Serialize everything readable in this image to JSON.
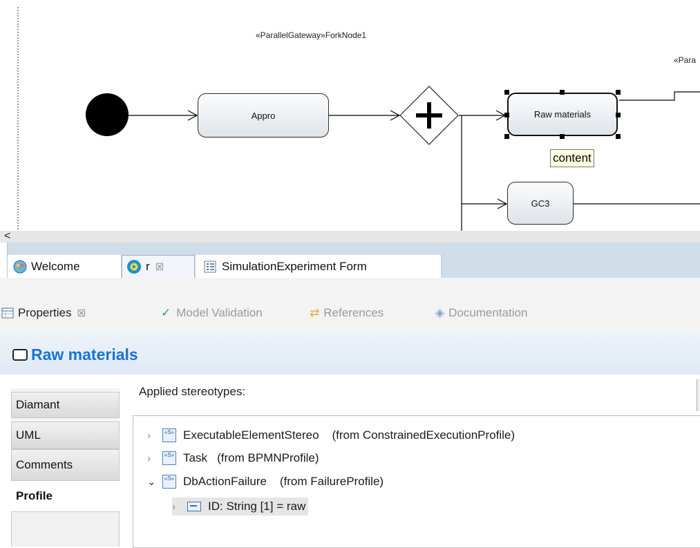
{
  "diagram": {
    "stereotype_fork": "«ParallelGateway»ForkNode1",
    "stereotype_right": "«Para",
    "node_appro": "Appro",
    "node_raw": "Raw materials",
    "node_gc3": "GC3",
    "tooltip": "content"
  },
  "editor_tabs": [
    {
      "label": "Welcome",
      "icon": "welcome-icon"
    },
    {
      "label": "r",
      "icon": "diagram-icon",
      "close": "☒"
    },
    {
      "label": "SimulationExperiment Form",
      "icon": "form-icon"
    }
  ],
  "view_tabs": [
    {
      "label": "Properties",
      "icon": "properties-icon",
      "close": "☒"
    },
    {
      "label": "Model Validation",
      "icon": "check-icon"
    },
    {
      "label": "References",
      "icon": "references-icon"
    },
    {
      "label": "Documentation",
      "icon": "documentation-icon"
    }
  ],
  "properties": {
    "title": "Raw materials",
    "side_tabs": [
      "Diamant",
      "UML",
      "Comments",
      "Profile"
    ],
    "selected_tab": "Profile",
    "applied_label": "Applied stereotypes:",
    "tree": [
      {
        "name": "ExecutableElementStereo",
        "from": "(from ConstrainedExecutionProfile)",
        "expanded": false
      },
      {
        "name": "Task",
        "from": "(from BPMNProfile)",
        "expanded": false
      },
      {
        "name": "DbActionFailure",
        "from": "(from FailureProfile)",
        "expanded": true
      },
      {
        "name": "ID: String [1] = raw",
        "from": "",
        "expanded": false
      }
    ]
  },
  "scroll": {
    "left_arrow": "<"
  },
  "colors": {
    "title_blue": "#1873d6",
    "tab_bar": "#cfdde9"
  }
}
